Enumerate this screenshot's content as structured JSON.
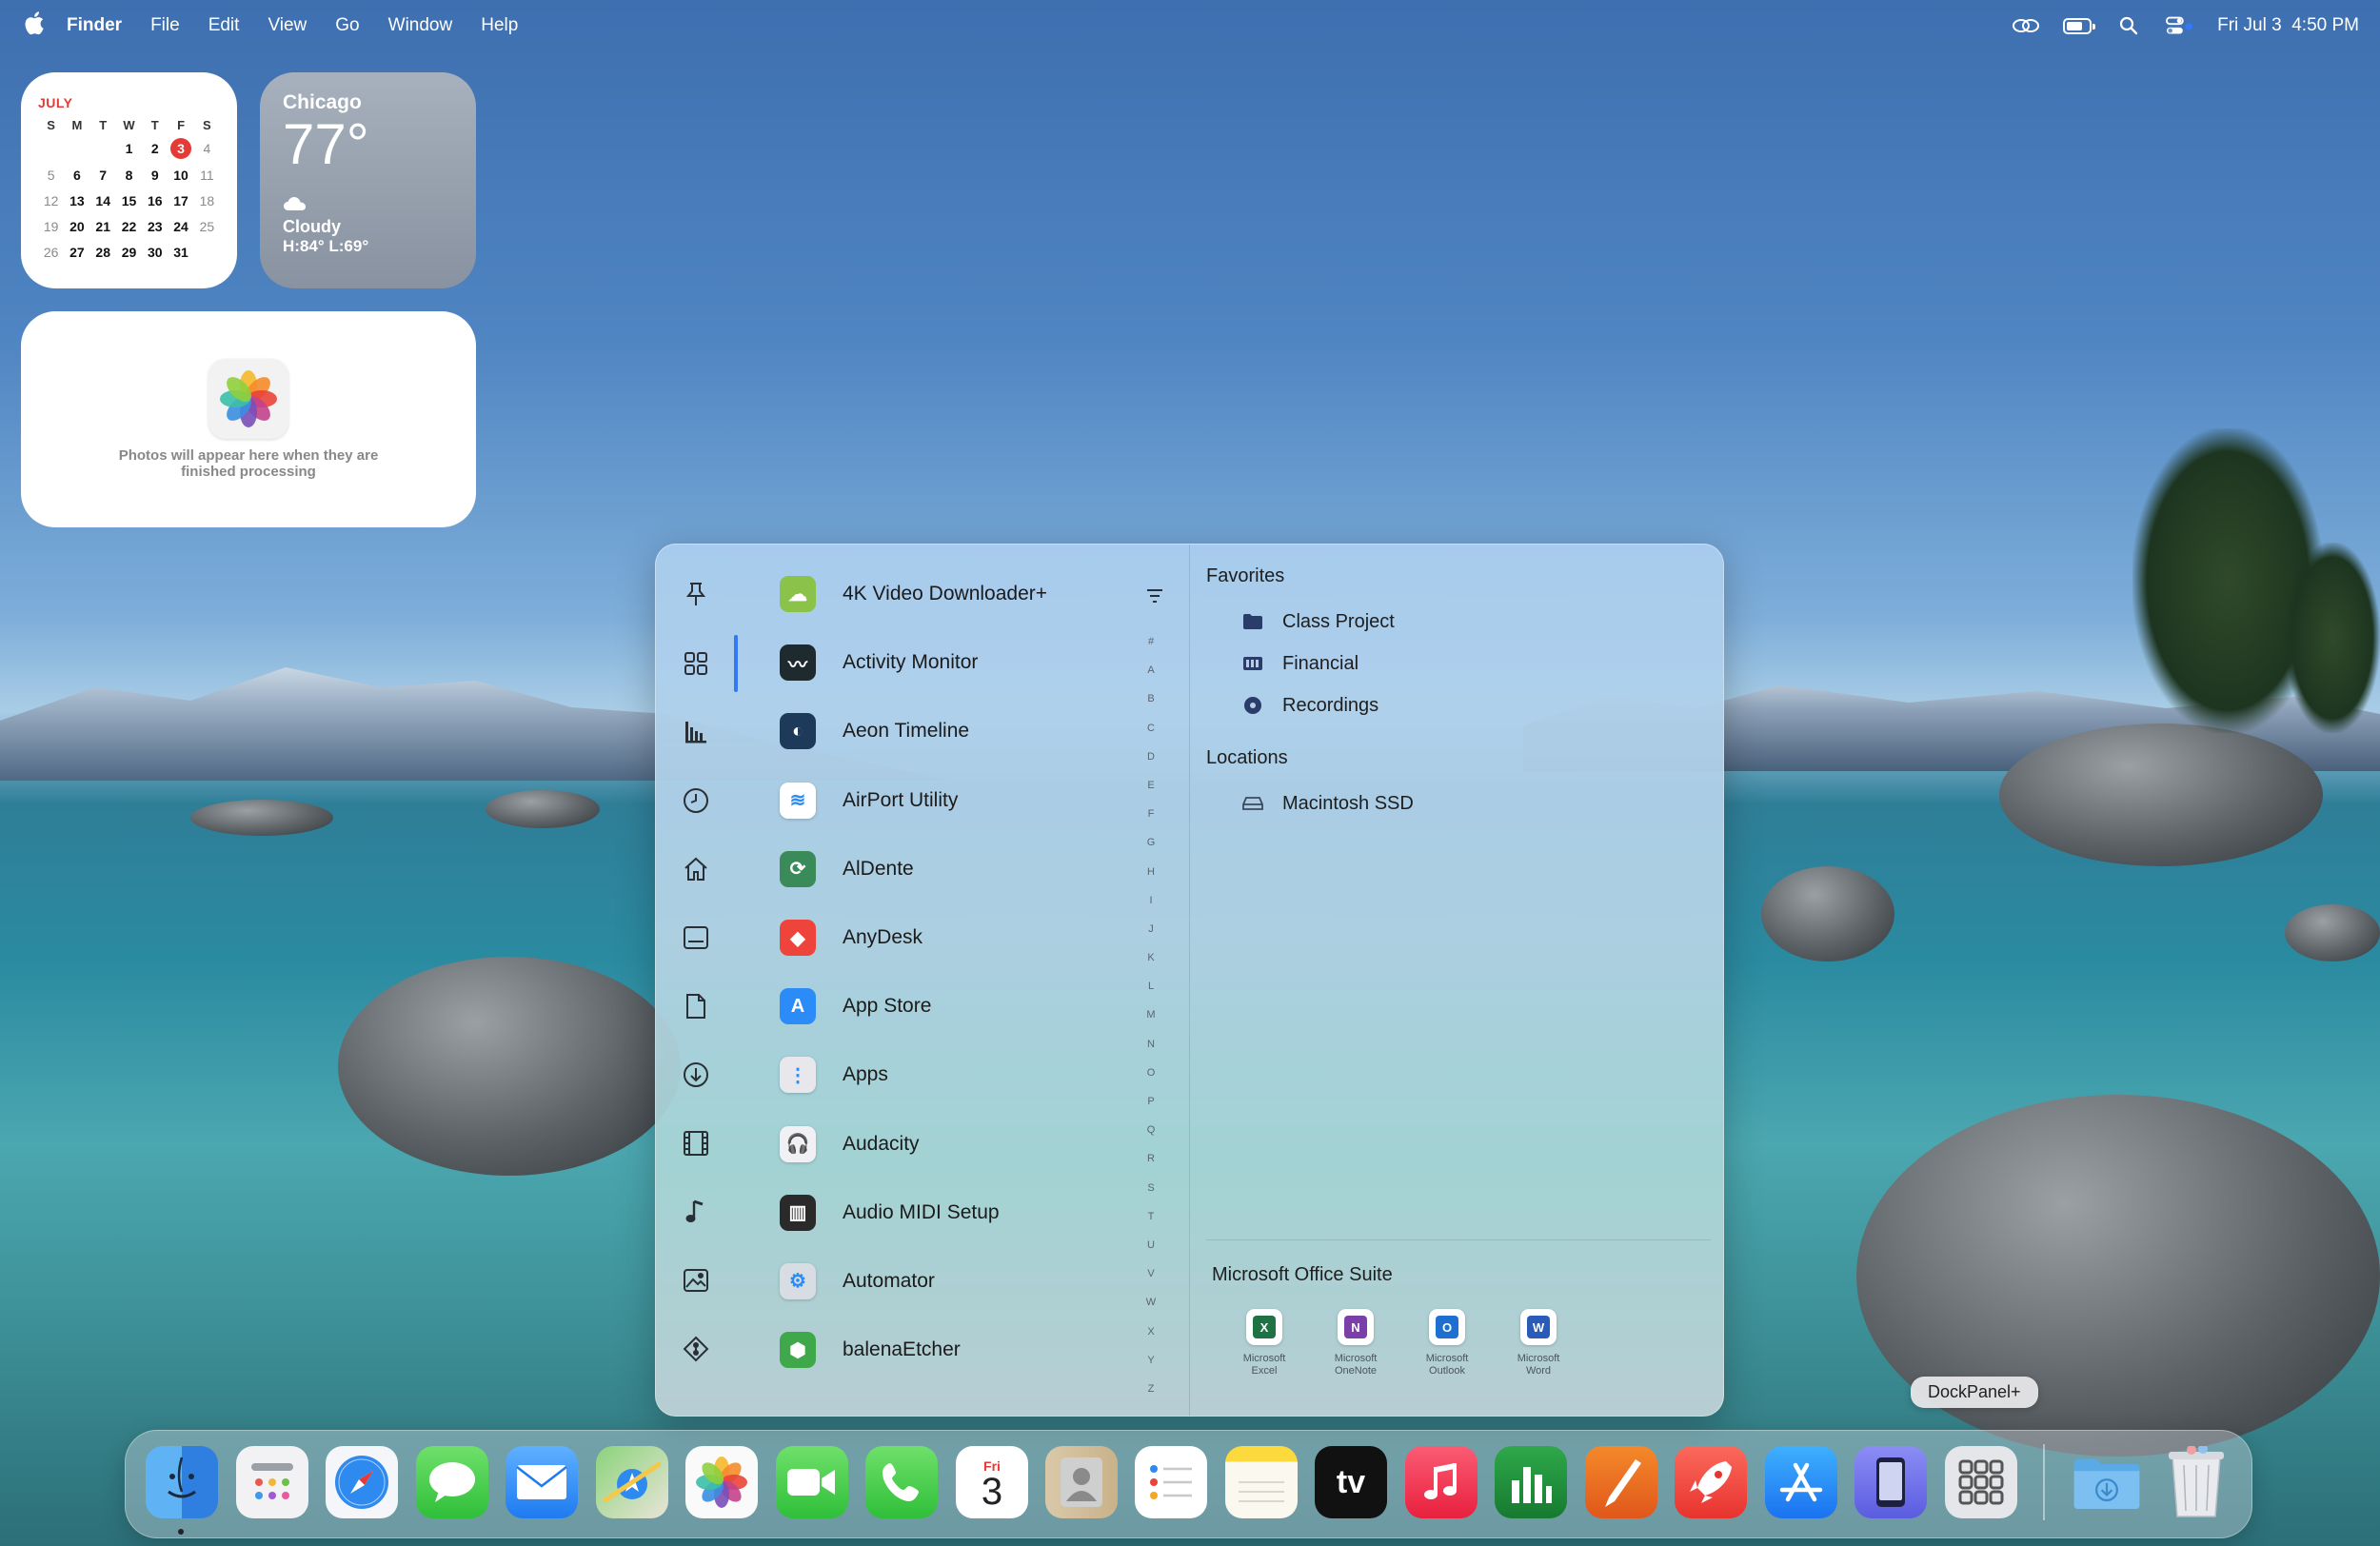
{
  "menubar": {
    "app": "Finder",
    "items": [
      "File",
      "Edit",
      "View",
      "Go",
      "Window",
      "Help"
    ],
    "datetime": "Fri Jul 3  4:50 PM"
  },
  "calendar_widget": {
    "month": "JULY",
    "dow": [
      "S",
      "M",
      "T",
      "W",
      "T",
      "F",
      "S"
    ],
    "weeks": [
      [
        "",
        "",
        "",
        "1",
        "2",
        "3",
        "4"
      ],
      [
        "5",
        "6",
        "7",
        "8",
        "9",
        "10",
        "11"
      ],
      [
        "12",
        "13",
        "14",
        "15",
        "16",
        "17",
        "18"
      ],
      [
        "19",
        "20",
        "21",
        "22",
        "23",
        "24",
        "25"
      ],
      [
        "26",
        "27",
        "28",
        "29",
        "30",
        "31",
        ""
      ]
    ],
    "today": "3"
  },
  "weather_widget": {
    "city": "Chicago",
    "temp": "77°",
    "condition": "Cloudy",
    "hilo": "H:84° L:69°"
  },
  "photos_widget": {
    "message": "Photos will appear here when they are finished processing"
  },
  "panel": {
    "sidebar_icons": [
      "pin-icon",
      "grid-icon",
      "chart-icon",
      "clock-icon",
      "home-icon",
      "window-icon",
      "document-icon",
      "download-icon",
      "film-icon",
      "music-icon",
      "image-icon",
      "git-icon"
    ],
    "apps": [
      {
        "name": "4K Video Downloader+",
        "color": "#8bc34a",
        "glyph": "☁"
      },
      {
        "name": "Activity Monitor",
        "color": "#1f2a2e",
        "glyph": "〰"
      },
      {
        "name": "Aeon Timeline",
        "color": "#1e3a5a",
        "glyph": "◐"
      },
      {
        "name": "AirPort Utility",
        "color": "#ffffff",
        "glyph": "≋"
      },
      {
        "name": "AlDente",
        "color": "#3a8a5a",
        "glyph": "⟳"
      },
      {
        "name": "AnyDesk",
        "color": "#ef443b",
        "glyph": "◆"
      },
      {
        "name": "App Store",
        "color": "#2b8cf7",
        "glyph": "A"
      },
      {
        "name": "Apps",
        "color": "#e8e8ec",
        "glyph": "⋮"
      },
      {
        "name": "Audacity",
        "color": "#f0f0f5",
        "glyph": "🎧"
      },
      {
        "name": "Audio MIDI Setup",
        "color": "#2a2a2a",
        "glyph": "▥"
      },
      {
        "name": "Automator",
        "color": "#d8dde3",
        "glyph": "⚙"
      },
      {
        "name": "balenaEtcher",
        "color": "#3fa84a",
        "glyph": "⬢"
      }
    ],
    "index_letters": [
      "#",
      "A",
      "B",
      "C",
      "D",
      "E",
      "F",
      "G",
      "H",
      "I",
      "J",
      "K",
      "L",
      "M",
      "N",
      "O",
      "P",
      "Q",
      "R",
      "S",
      "T",
      "U",
      "V",
      "W",
      "X",
      "Y",
      "Z"
    ],
    "favorites_title": "Favorites",
    "favorites": [
      {
        "name": "Class Project",
        "icon": "folder-icon"
      },
      {
        "name": "Financial",
        "icon": "drive-icon"
      },
      {
        "name": "Recordings",
        "icon": "disc-icon"
      }
    ],
    "locations_title": "Locations",
    "locations": [
      {
        "name": "Macintosh SSD",
        "icon": "hard-drive-icon"
      }
    ],
    "suite_title": "Microsoft Office Suite",
    "suite": [
      {
        "line1": "Microsoft",
        "line2": "Excel",
        "letter": "X",
        "color": "#1f7244"
      },
      {
        "line1": "Microsoft",
        "line2": "OneNote",
        "letter": "N",
        "color": "#7a3fa8"
      },
      {
        "line1": "Microsoft",
        "line2": "Outlook",
        "letter": "O",
        "color": "#1d6fd0"
      },
      {
        "line1": "Microsoft",
        "line2": "Word",
        "letter": "W",
        "color": "#2a5bb8"
      }
    ]
  },
  "tooltip": "DockPanel+",
  "dock": {
    "apps": [
      {
        "name": "Finder",
        "icon": "finder-icon"
      },
      {
        "name": "Launchpad",
        "icon": "launchpad-icon"
      },
      {
        "name": "Safari",
        "icon": "safari-icon"
      },
      {
        "name": "Messages",
        "icon": "messages-icon"
      },
      {
        "name": "Mail",
        "icon": "mail-icon"
      },
      {
        "name": "Maps",
        "icon": "maps-icon"
      },
      {
        "name": "Photos",
        "icon": "photos-icon"
      },
      {
        "name": "FaceTime",
        "icon": "facetime-icon"
      },
      {
        "name": "Phone",
        "icon": "phone-icon"
      },
      {
        "name": "Calendar",
        "icon": "calendar-icon",
        "day_label": "Fri",
        "day_number": "3"
      },
      {
        "name": "Contacts",
        "icon": "contacts-icon"
      },
      {
        "name": "Reminders",
        "icon": "reminders-icon"
      },
      {
        "name": "Notes",
        "icon": "notes-icon"
      },
      {
        "name": "TV",
        "icon": "tv-icon",
        "label": "tv"
      },
      {
        "name": "Music",
        "icon": "music-icon"
      },
      {
        "name": "Numbers",
        "icon": "numbers-icon"
      },
      {
        "name": "Pages",
        "icon": "pages-icon"
      },
      {
        "name": "RocketSim",
        "icon": "rocket-icon"
      },
      {
        "name": "App Store",
        "icon": "app-store-icon"
      },
      {
        "name": "Simulator",
        "icon": "simulator-icon"
      },
      {
        "name": "DockPanel+",
        "icon": "dockpanel-icon"
      },
      {
        "name": "Downloads",
        "icon": "downloads-folder-icon"
      },
      {
        "name": "Trash",
        "icon": "trash-icon"
      }
    ]
  }
}
